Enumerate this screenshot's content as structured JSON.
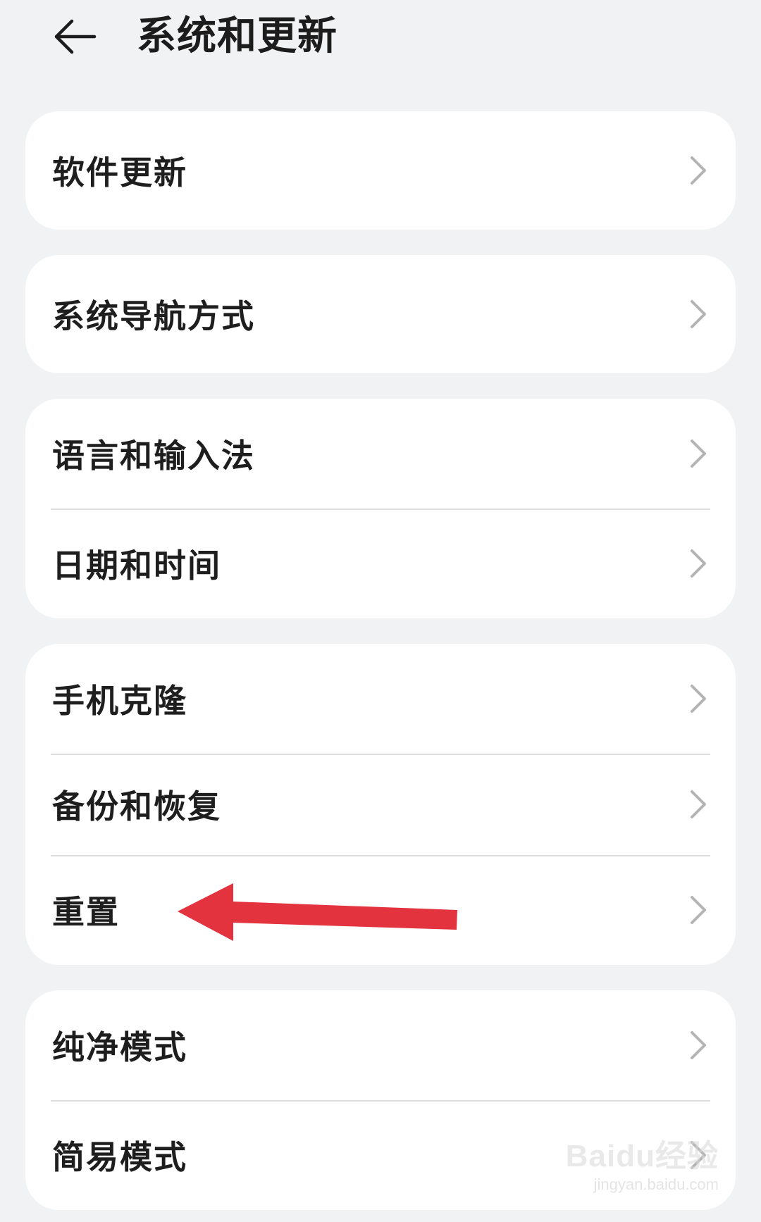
{
  "header": {
    "title": "系统和更新"
  },
  "groups": [
    {
      "items": [
        {
          "label": "软件更新"
        }
      ]
    },
    {
      "items": [
        {
          "label": "系统导航方式"
        }
      ]
    },
    {
      "items": [
        {
          "label": "语言和输入法"
        },
        {
          "label": "日期和时间"
        }
      ]
    },
    {
      "items": [
        {
          "label": "手机克隆"
        },
        {
          "label": "备份和恢复"
        },
        {
          "label": "重置"
        }
      ]
    },
    {
      "items": [
        {
          "label": "纯净模式"
        },
        {
          "label": "简易模式"
        }
      ]
    }
  ],
  "annotation": {
    "arrow_color": "#e2333f",
    "target": "重置"
  },
  "watermark": {
    "main": "Baidu经验",
    "sub": "jingyan.baidu.com"
  },
  "colors": {
    "background": "#f1f2f4",
    "card": "#ffffff",
    "chevron": "#b4b4b4"
  }
}
